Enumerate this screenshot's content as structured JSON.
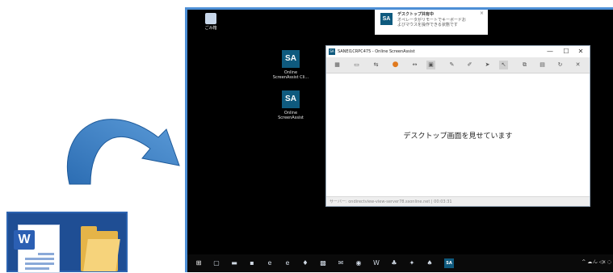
{
  "remote": {
    "recycle_label": "ごみ箱",
    "desktop_icons": [
      {
        "name": "Online\nScreenAssist Cli...",
        "glyph": "SA"
      },
      {
        "name": "Online\nScreenAssist",
        "glyph": "SA"
      }
    ],
    "notification": {
      "icon": "SA",
      "title": "デスクトップ共有中",
      "message": "オペレータがリモートでキーボードおよびマウスを操作できる状態です",
      "close": "×"
    },
    "app": {
      "title": "SANEI1CRPC475 - Online ScreenAssist",
      "title_icon": "SA",
      "minimize": "—",
      "maximize": "☐",
      "close": "✕",
      "content_message": "デスクトップ画面を見せています",
      "status_text": "サーバー: ondirectview-view-server78.ssonline.net | 00:03:31"
    },
    "taskbar": {
      "sa_label": "SA",
      "tray": "^ ☁ ⁄ᴗ ◁x ◌"
    }
  },
  "local": {
    "word_badge": "W"
  }
}
